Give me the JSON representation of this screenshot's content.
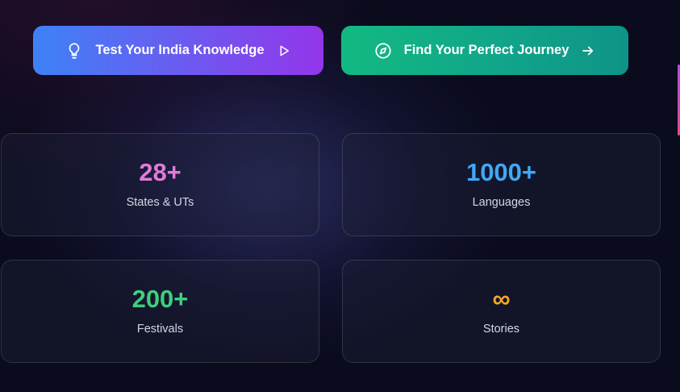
{
  "actions": {
    "quiz": {
      "label": "Test Your India Knowledge",
      "lead_icon": "lightbulb-icon",
      "trail_icon": "play-icon"
    },
    "journey": {
      "label": "Find Your Perfect Journey",
      "lead_icon": "compass-icon",
      "trail_icon": "arrow-right-icon"
    }
  },
  "stats": [
    {
      "value": "28+",
      "label": "States & UTs",
      "color": "#e07bd9"
    },
    {
      "value": "1000+",
      "label": "Languages",
      "color": "#3fa9f5"
    },
    {
      "value": "200+",
      "label": "Festivals",
      "color": "#3ecf7e"
    },
    {
      "value": "∞",
      "label": "Stories",
      "color": "#f3a72a"
    }
  ],
  "colors": {
    "quiz_gradient": [
      "#3d82f6",
      "#9336ea"
    ],
    "journey_gradient": [
      "#12b981",
      "#0e9487"
    ],
    "background": "#0a0b1c"
  }
}
